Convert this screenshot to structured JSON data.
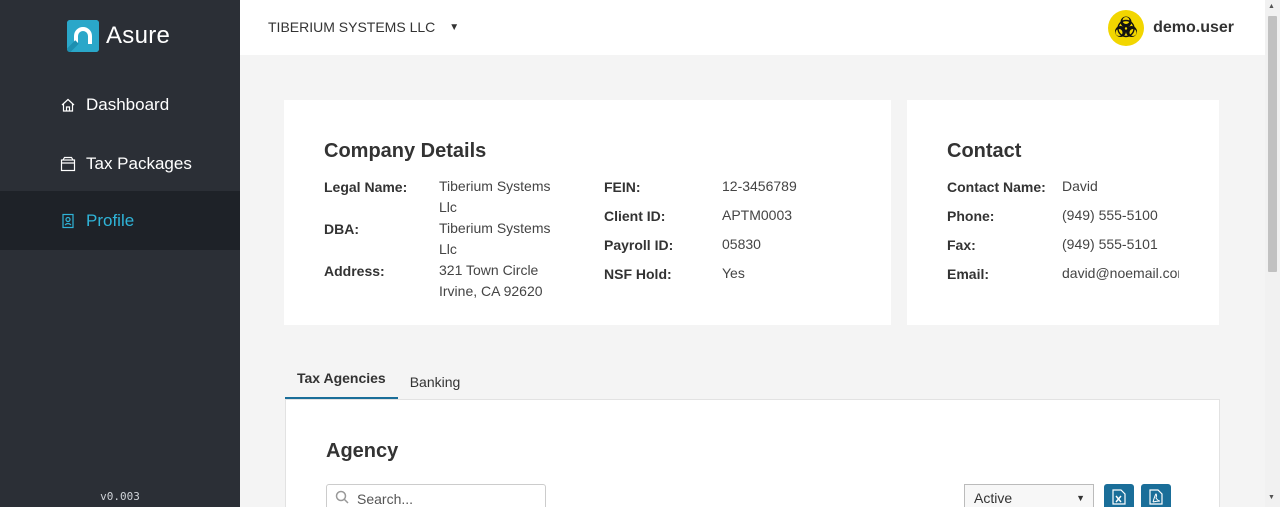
{
  "sidebar": {
    "logo_text": "Asure",
    "items": [
      {
        "label": "Dashboard",
        "icon": "home-icon"
      },
      {
        "label": "Tax Packages",
        "icon": "package-icon"
      },
      {
        "label": "Profile",
        "icon": "profile-icon",
        "active": true
      }
    ],
    "version": "v0.003"
  },
  "topbar": {
    "company": "TIBERIUM SYSTEMS LLC",
    "username": "demo.user",
    "avatar_icon": "biohazard-icon"
  },
  "company_details": {
    "title": "Company Details",
    "legal_name_label": "Legal Name:",
    "legal_name_line1": "Tiberium Systems",
    "legal_name_line2": "Llc",
    "dba_label": "DBA:",
    "dba_line1": "Tiberium Systems",
    "dba_line2": "Llc",
    "address_label": "Address:",
    "address_line1": "321 Town Circle",
    "address_line2": "Irvine, CA 92620",
    "fein_label": "FEIN:",
    "fein": "12-3456789",
    "client_id_label": "Client ID:",
    "client_id": "APTM0003",
    "payroll_id_label": "Payroll ID:",
    "payroll_id": "05830",
    "nsf_hold_label": "NSF Hold:",
    "nsf_hold": "Yes"
  },
  "contact": {
    "title": "Contact",
    "name_label": "Contact Name:",
    "name": "David",
    "phone_label": "Phone:",
    "phone": "(949) 555-5100",
    "fax_label": "Fax:",
    "fax": "(949) 555-5101",
    "email_label": "Email:",
    "email": "david@noemail.com"
  },
  "tabs": [
    {
      "label": "Tax Agencies",
      "active": true
    },
    {
      "label": "Banking"
    }
  ],
  "agency": {
    "title": "Agency",
    "search_placeholder": "Search...",
    "status_selected": "Active",
    "export_excel_icon": "excel-export-icon",
    "export_pdf_icon": "pdf-export-icon"
  },
  "colors": {
    "sidebar_bg": "#2b2f36",
    "active_nav": "#2fb4d8",
    "accent": "#1a6e99",
    "logo": "#2aa7c9"
  }
}
